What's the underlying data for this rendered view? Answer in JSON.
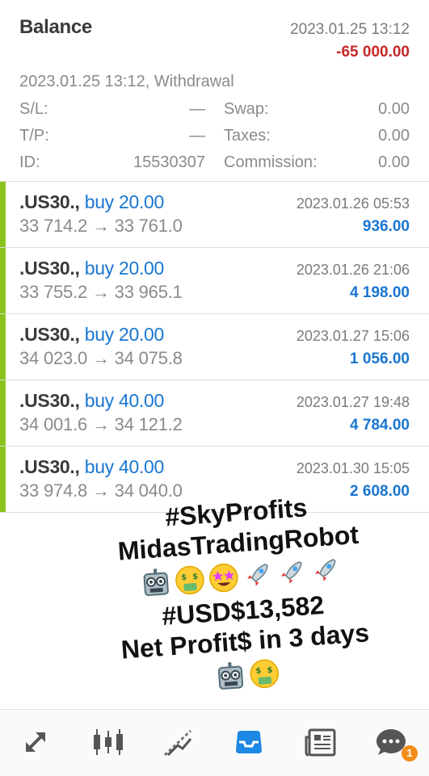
{
  "balance": {
    "title": "Balance",
    "time": "2023.01.25 13:12",
    "amount": "-65 000.00",
    "subtitle": "2023.01.25 13:12, Withdrawal",
    "fields": {
      "sl_label": "S/L:",
      "sl_value": "—",
      "tp_label": "T/P:",
      "tp_value": "—",
      "id_label": "ID:",
      "id_value": "15530307",
      "swap_label": "Swap:",
      "swap_value": "0.00",
      "taxes_label": "Taxes:",
      "taxes_value": "0.00",
      "commission_label": "Commission:",
      "commission_value": "0.00"
    }
  },
  "trades": [
    {
      "symbol": ".US30.,",
      "direction": "buy 20.00",
      "prices": "33 714.2 → 33 761.0",
      "time": "2023.01.26 05:53",
      "profit": "936.00"
    },
    {
      "symbol": ".US30.,",
      "direction": "buy 20.00",
      "prices": "33 755.2 → 33 965.1",
      "time": "2023.01.26 21:06",
      "profit": "4 198.00"
    },
    {
      "symbol": ".US30.,",
      "direction": "buy 20.00",
      "prices": "34 023.0 → 34 075.8",
      "time": "2023.01.27 15:06",
      "profit": "1 056.00"
    },
    {
      "symbol": ".US30.,",
      "direction": "buy 40.00",
      "prices": "34 001.6 → 34 121.2",
      "time": "2023.01.27 19:48",
      "profit": "4 784.00"
    },
    {
      "symbol": ".US30.,",
      "direction": "buy 40.00",
      "prices": "33 974.8 → 34 040.0",
      "time": "2023.01.30 15:05",
      "profit": "2 608.00"
    }
  ],
  "overlay": {
    "line1": "#SkyProfits",
    "line2": "MidasTradingRobot",
    "line3": "#USD$13,582",
    "line4": "Net Profit$ in 3 days",
    "emojis_row1": [
      "robot-emoji",
      "money-mouth-emoji",
      "star-struck-emoji",
      "rocket-emoji",
      "rocket-emoji",
      "rocket-emoji"
    ],
    "emojis_row2": [
      "robot-emoji",
      "money-mouth-emoji"
    ]
  },
  "nav": {
    "items": [
      "trade-arrows-icon",
      "candlestick-chart-icon",
      "trend-line-icon",
      "inbox-tray-icon",
      "news-icon",
      "chat-icon"
    ],
    "active_index": 3,
    "chat_badge": "1"
  },
  "colors": {
    "accent_blue": "#1976d2",
    "loss_red": "#c62828",
    "profit_bar_green": "#8cc21e",
    "badge_orange": "#f28c1a"
  }
}
